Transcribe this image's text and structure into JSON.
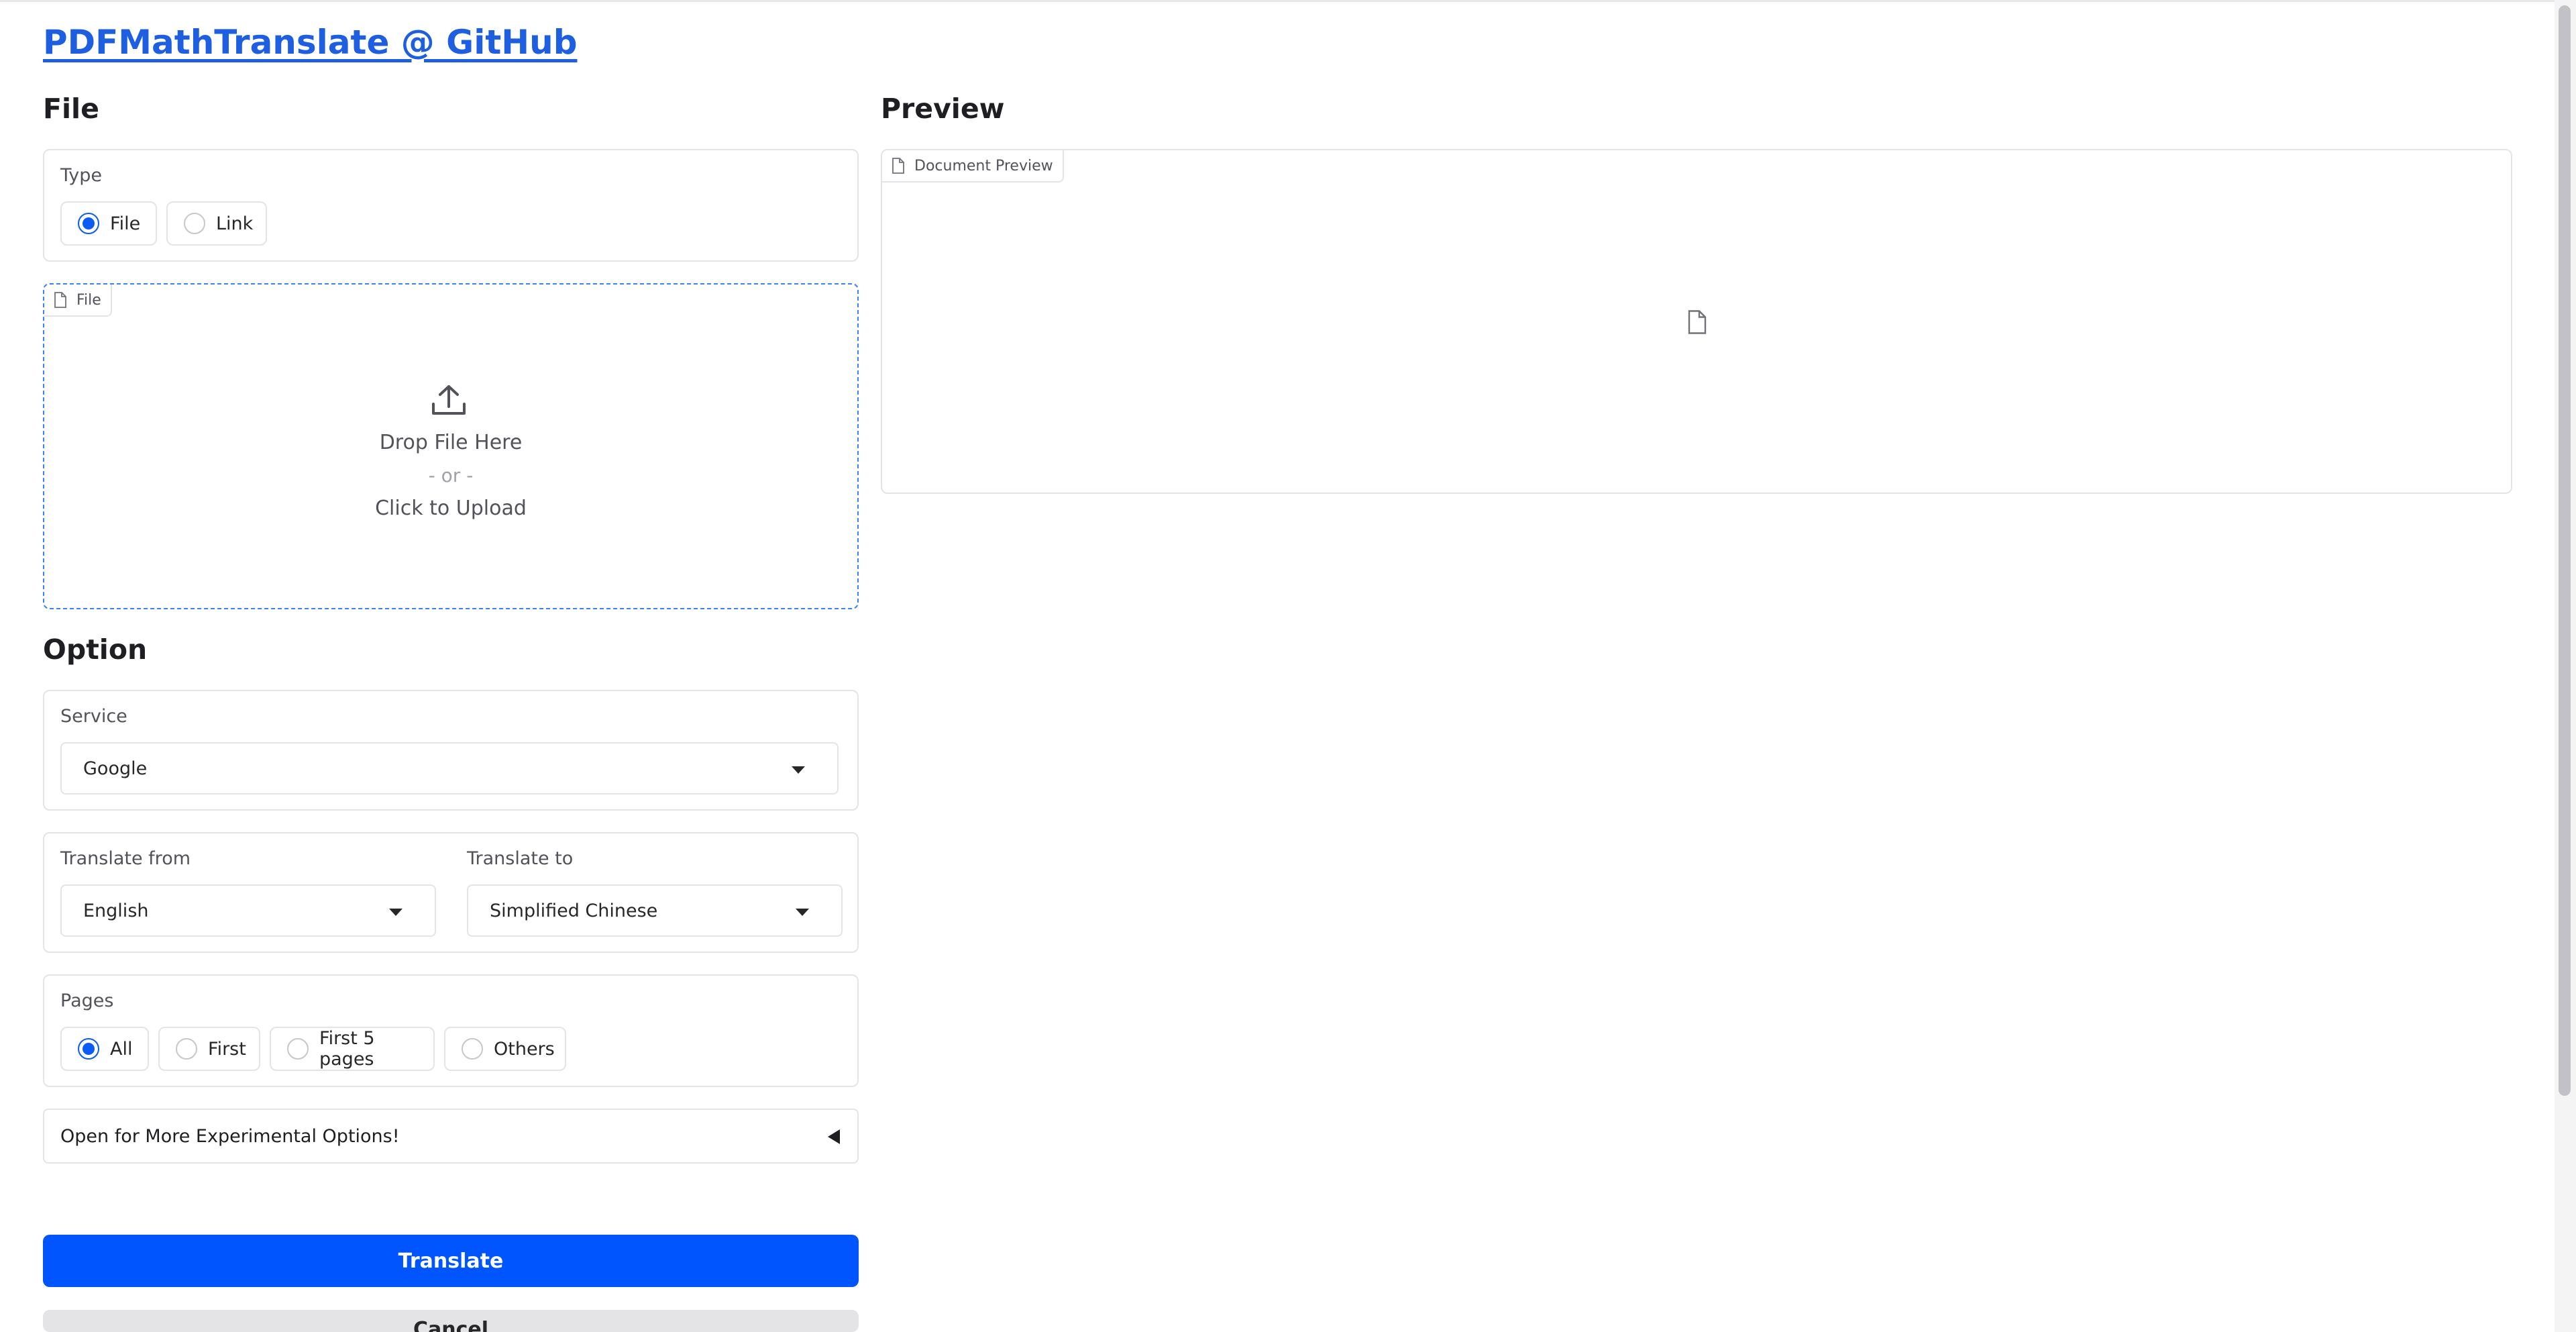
{
  "header": {
    "title": "PDFMathTranslate @ GitHub"
  },
  "file_section": {
    "heading": "File",
    "type_label": "Type",
    "type_options": [
      {
        "label": "File",
        "selected": true
      },
      {
        "label": "Link",
        "selected": false
      }
    ],
    "upload_tag": "File",
    "drop_text": "Drop File Here",
    "or_text": "- or -",
    "click_text": "Click to Upload"
  },
  "option_section": {
    "heading": "Option",
    "service_label": "Service",
    "service_value": "Google",
    "translate_from_label": "Translate from",
    "translate_from_value": "English",
    "translate_to_label": "Translate to",
    "translate_to_value": "Simplified Chinese",
    "pages_label": "Pages",
    "pages_options": [
      {
        "label": "All",
        "selected": true
      },
      {
        "label": "First",
        "selected": false
      },
      {
        "label": "First 5 pages",
        "selected": false
      },
      {
        "label": "Others",
        "selected": false
      }
    ],
    "experimental_label": "Open for More Experimental Options!"
  },
  "actions": {
    "translate_label": "Translate",
    "cancel_label": "Cancel"
  },
  "preview_section": {
    "heading": "Preview",
    "tag": "Document Preview"
  },
  "colors": {
    "accent": "#0055ff",
    "link": "#1d5fe0",
    "border": "#e4e4e7"
  }
}
